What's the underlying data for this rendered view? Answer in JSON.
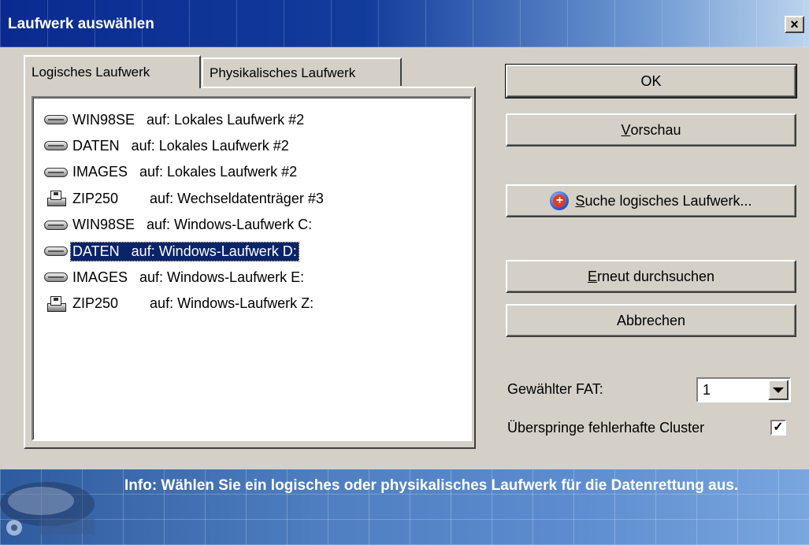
{
  "window": {
    "title": "Laufwerk auswählen",
    "close_glyph": "×"
  },
  "tabs": [
    {
      "label": "Logisches Laufwerk",
      "active": true
    },
    {
      "label": "Physikalisches Laufwerk",
      "active": false
    }
  ],
  "drives": [
    {
      "text": "WIN98SE   auf: Lokales Laufwerk #2",
      "icon": "hard-drive-icon",
      "selected": false
    },
    {
      "text": "DATEN   auf: Lokales Laufwerk #2",
      "icon": "hard-drive-icon",
      "selected": false
    },
    {
      "text": "IMAGES   auf: Lokales Laufwerk #2",
      "icon": "hard-drive-icon",
      "selected": false
    },
    {
      "text": "ZIP250        auf: Wechseldatenträger #3",
      "icon": "zip-drive-icon",
      "selected": false
    },
    {
      "text": "WIN98SE   auf: Windows-Laufwerk C:",
      "icon": "hard-drive-icon",
      "selected": false
    },
    {
      "text": "DATEN   auf: Windows-Laufwerk D:",
      "icon": "hard-drive-icon",
      "selected": true
    },
    {
      "text": "IMAGES   auf: Windows-Laufwerk E:",
      "icon": "hard-drive-icon",
      "selected": false
    },
    {
      "text": "ZIP250        auf: Windows-Laufwerk Z:",
      "icon": "zip-drive-icon",
      "selected": false
    }
  ],
  "buttons": {
    "ok": "OK",
    "preview_accel": "V",
    "preview_rest": "orschau",
    "search_accel": "S",
    "search_rest": "uche logisches Laufwerk...",
    "rescan_accel": "E",
    "rescan_rest": "rneut durchsuchen",
    "cancel": "Abbrechen"
  },
  "fat": {
    "label": "Gewählter FAT:",
    "value": "1"
  },
  "skip_bad_clusters": {
    "label": "Überspringe fehlerhafte Cluster",
    "checked": true,
    "check_glyph": "✓"
  },
  "info": {
    "text": "Info: Wählen Sie ein logisches oder physikalisches Laufwerk für die Datenrettung aus."
  },
  "colors": {
    "title_bar": "#0a2a8f",
    "selection": "#0a246a",
    "info_bar": "#4f7fc0",
    "face": "#d4d0c8"
  }
}
